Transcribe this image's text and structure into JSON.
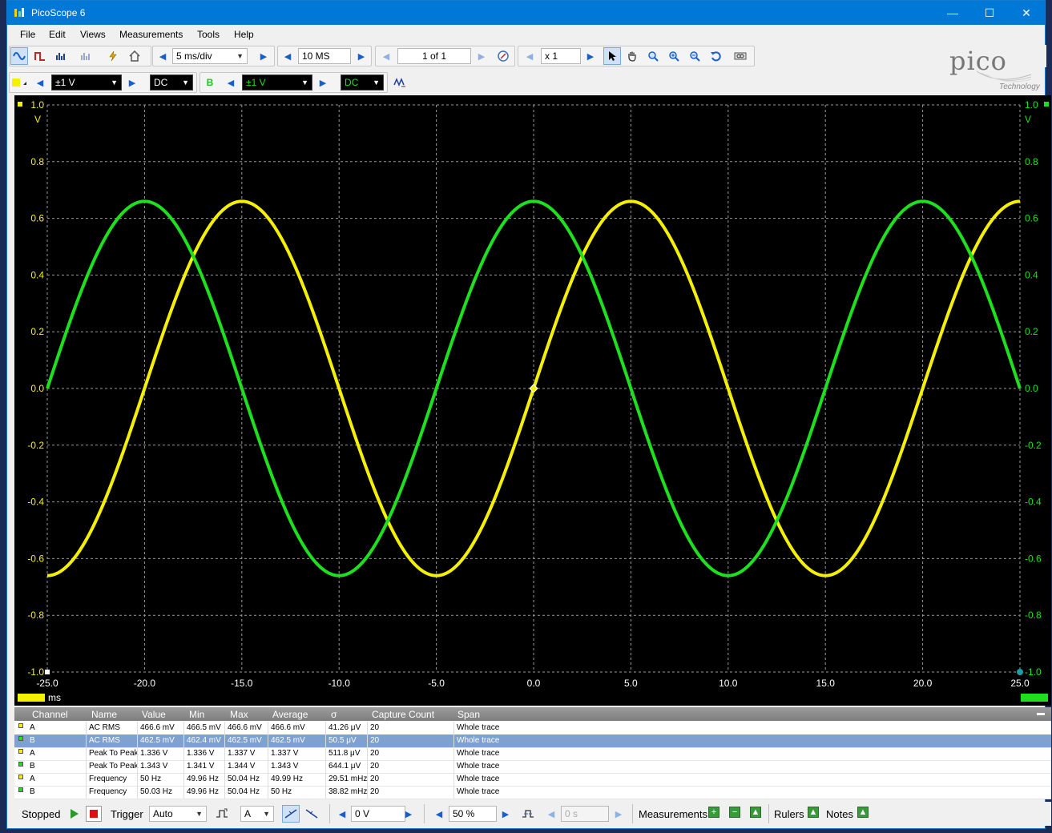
{
  "window": {
    "title": "PicoScope 6",
    "minimize": "—",
    "maximize": "☐",
    "close": "✕"
  },
  "menu": [
    "File",
    "Edit",
    "Views",
    "Measurements",
    "Tools",
    "Help"
  ],
  "toolbar": {
    "timebase": "5 ms/div",
    "samples": "10 MS",
    "buffer": "1 of 1",
    "zoom": "x 1",
    "channel_a_range": "±1 V",
    "channel_a_coupling": "DC",
    "channel_b_label": "B",
    "channel_b_range": "±1 V",
    "channel_b_coupling": "DC"
  },
  "brand": {
    "logo": "pico",
    "sub": "Technology"
  },
  "chart_data": {
    "type": "line",
    "xlim": [
      -25,
      25
    ],
    "ylim": [
      -1,
      1
    ],
    "x_ticks": [
      "-25.0",
      "-20.0",
      "-15.0",
      "-10.0",
      "-5.0",
      "0.0",
      "5.0",
      "10.0",
      "15.0",
      "20.0",
      "25.0"
    ],
    "y_ticks": [
      "1.0",
      "0.8",
      "0.6",
      "0.4",
      "0.2",
      "0.0",
      "-0.2",
      "-0.4",
      "-0.6",
      "-0.8",
      "-1.0"
    ],
    "y_unit_left": "V",
    "y_unit_right": "V",
    "x_unit": "ms",
    "grid": true,
    "series": [
      {
        "channel": "A",
        "color": "#f5f000",
        "amplitude": 0.66,
        "frequency_hz": 50,
        "phase_deg": 0
      },
      {
        "channel": "B",
        "color": "#1ee01e",
        "amplitude": 0.66,
        "frequency_hz": 50,
        "phase_deg": 90
      }
    ]
  },
  "measurements": {
    "headers": [
      "Channel",
      "Name",
      "Value",
      "Min",
      "Max",
      "Average",
      "σ",
      "Capture Count",
      "Span"
    ],
    "rows": [
      [
        "A",
        "AC RMS",
        "466.6 mV",
        "466.5 mV",
        "466.6 mV",
        "466.6 mV",
        "41.26 μV",
        "20",
        "Whole trace"
      ],
      [
        "B",
        "AC RMS",
        "462.5 mV",
        "462.4 mV",
        "462.5 mV",
        "462.5 mV",
        "50.5 μV",
        "20",
        "Whole trace"
      ],
      [
        "A",
        "Peak To Peak",
        "1.336 V",
        "1.336 V",
        "1.337 V",
        "1.337 V",
        "511.8 μV",
        "20",
        "Whole trace"
      ],
      [
        "B",
        "Peak To Peak",
        "1.343 V",
        "1.341 V",
        "1.344 V",
        "1.343 V",
        "644.1 μV",
        "20",
        "Whole trace"
      ],
      [
        "A",
        "Frequency",
        "50 Hz",
        "49.96 Hz",
        "50.04 Hz",
        "49.99 Hz",
        "29.51 mHz",
        "20",
        "Whole trace"
      ],
      [
        "B",
        "Frequency",
        "50.03 Hz",
        "49.96 Hz",
        "50.04 Hz",
        "50 Hz",
        "38.82 mHz",
        "20",
        "Whole trace"
      ]
    ],
    "selected_row": 1
  },
  "status": {
    "state": "Stopped",
    "trigger_label": "Trigger",
    "trigger_mode": "Auto",
    "trigger_channel": "A",
    "threshold": "0 V",
    "pretrigger": "50 %",
    "delay": "0 s",
    "measurements_label": "Measurements",
    "rulers_label": "Rulers",
    "notes_label": "Notes"
  }
}
